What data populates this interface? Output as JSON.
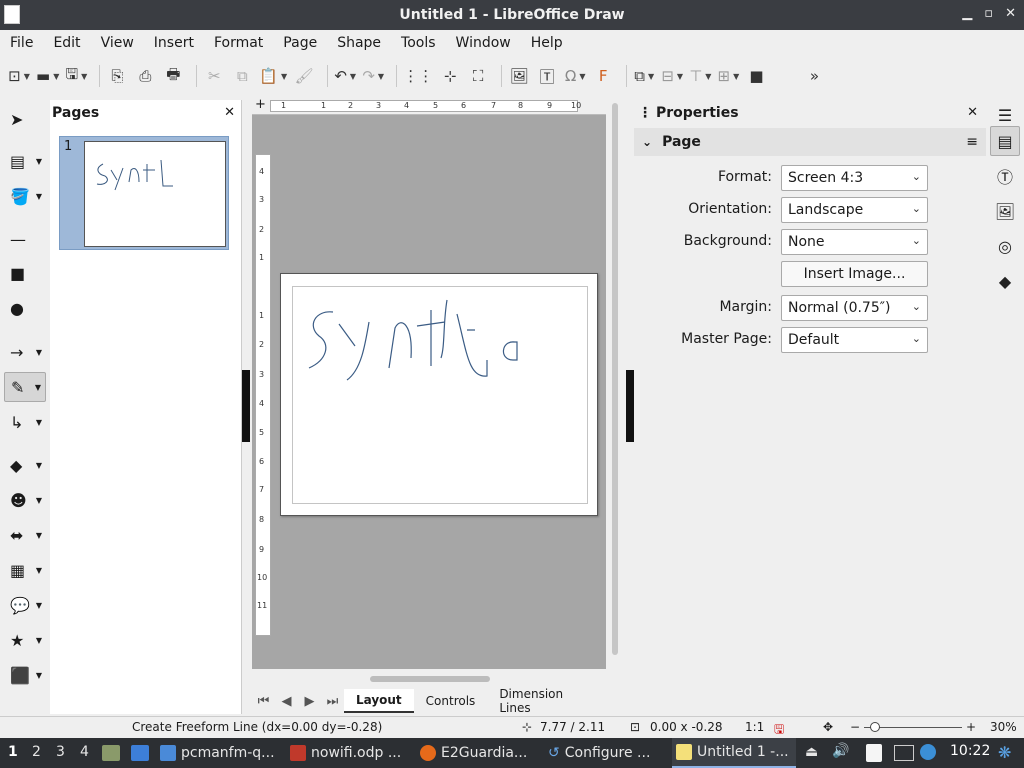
{
  "window": {
    "title": "Untitled 1 - LibreOffice Draw"
  },
  "menu": [
    "File",
    "Edit",
    "View",
    "Insert",
    "Format",
    "Page",
    "Shape",
    "Tools",
    "Window",
    "Help"
  ],
  "pages_panel": {
    "title": "Pages",
    "page_number": "1"
  },
  "ruler": {
    "h_ticks": [
      "1",
      "1",
      "2",
      "3",
      "4",
      "5",
      "6",
      "7",
      "8",
      "9",
      "10"
    ],
    "v_ticks": [
      "4",
      "3",
      "2",
      "1",
      "1",
      "2",
      "3",
      "4",
      "5",
      "6",
      "7",
      "8",
      "9",
      "10",
      "11"
    ]
  },
  "bottom_tabs": [
    "Layout",
    "Controls",
    "Dimension Lines"
  ],
  "properties": {
    "title": "Properties",
    "section": "Page",
    "format_label": "Format:",
    "format_value": "Screen 4:3",
    "orientation_label": "Orientation:",
    "orientation_value": "Landscape",
    "background_label": "Background:",
    "background_value": "None",
    "insert_image_label": "Insert Image...",
    "margin_label": "Margin:",
    "margin_value": "Normal (0.75″)",
    "master_label": "Master Page:",
    "master_value": "Default"
  },
  "status": {
    "message": "Create Freeform Line (dx=0.00 dy=-0.28)",
    "position": "7.77 / 2.11",
    "size": "0.00 x -0.28",
    "scale": "1:1",
    "zoom": "30%"
  },
  "taskbar": {
    "workspaces": [
      "1",
      "2",
      "3",
      "4"
    ],
    "tasks": [
      "pcmanfm-q...",
      "nowifi.odp ...",
      "E2Guardia...",
      "Configure ...",
      "Untitled 1 -..."
    ],
    "clock": "10:22"
  }
}
